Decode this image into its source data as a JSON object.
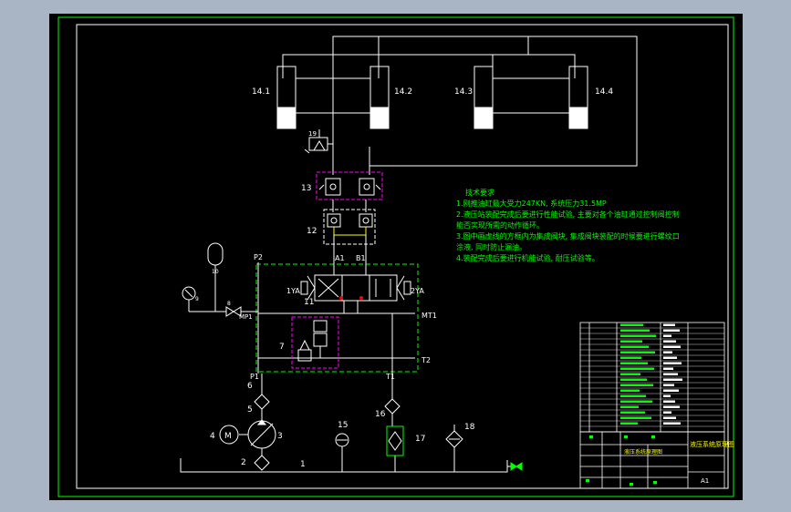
{
  "colors": {
    "page_bg": "#a9b4c4",
    "sheet": "#000000",
    "frame": "#00ff00",
    "lines": "#ffffff",
    "valve_block": "#00ff00",
    "subassembly": "#ff00ff",
    "accent_red": "#ff0000",
    "yellow": "#ffff00",
    "title_text": "#ffff00"
  },
  "components": {
    "cyl_14_1": "14.1",
    "cyl_14_2": "14.2",
    "cyl_14_3": "14.3",
    "cyl_14_4": "14.4",
    "c19": "19",
    "c13": "13",
    "c12": "12",
    "c11": "11",
    "c10": "10",
    "c9": "9",
    "c8": "8",
    "c7": "7",
    "c6": "6",
    "c5": "5",
    "c4": "4",
    "c3": "3",
    "c2": "2",
    "c1": "1",
    "c15": "15",
    "c16": "16",
    "c17": "17",
    "c18": "18",
    "motor_symbol": "M"
  },
  "ports": {
    "a1": "A1",
    "b1": "B1",
    "p2": "P2",
    "mp1": "MP1",
    "mt1": "MT1",
    "p1": "P1",
    "t1": "T1",
    "t2": "T2",
    "sol_left": "1YA",
    "sol_right": "2YA"
  },
  "requirements": {
    "title": "技术要求",
    "lines": [
      "1.刚推油缸最大受力247KN, 系统压力31.5MP",
      "2.液压站装配完成后要进行性能试验, 主要对各个油缸通过控制阀控制",
      "能否实现所需的动作循环。",
      "3.图中画虚线的方框内为集成阀块, 集成阀块装配的时候要进行螺纹口",
      "涂液, 同时防止漏油。",
      "4.装配完成后要进行机能试验, 耐压试验等。"
    ]
  },
  "title_block": {
    "name": "液压系统原理图",
    "drawing_no": "液压系统原理图",
    "sheet": "A1"
  }
}
